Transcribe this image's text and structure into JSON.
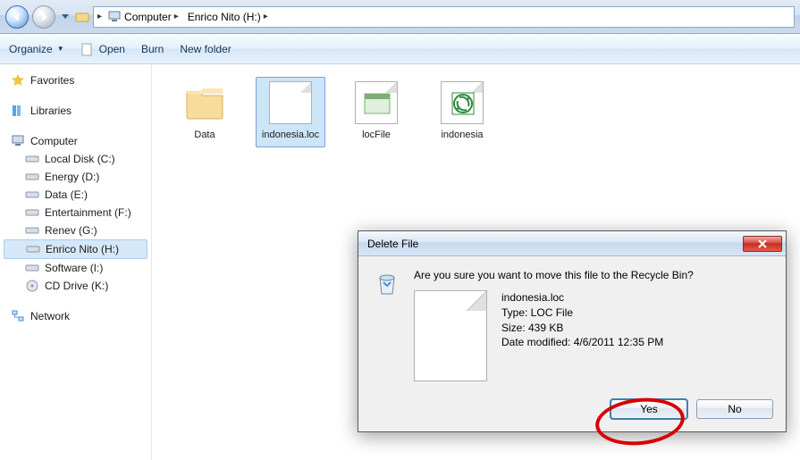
{
  "nav": {
    "crumbs": [
      "Computer",
      "Enrico Nito (H:)"
    ]
  },
  "toolbar": {
    "organize": "Organize",
    "open": "Open",
    "burn": "Burn",
    "newfolder": "New folder"
  },
  "sidebar": {
    "favorites": "Favorites",
    "libraries": "Libraries",
    "computer": "Computer",
    "drives": [
      "Local Disk (C:)",
      "Energy (D:)",
      "Data (E:)",
      "Entertainment (F:)",
      "Renev (G:)",
      "Enrico Nito (H:)",
      "Software (I:)",
      "CD Drive (K:)"
    ],
    "network": "Network"
  },
  "files": [
    {
      "name": "Data",
      "kind": "folder"
    },
    {
      "name": "indonesia.loc",
      "kind": "file",
      "selected": true
    },
    {
      "name": "locFile",
      "kind": "file-loc"
    },
    {
      "name": "indonesia",
      "kind": "file-xls"
    }
  ],
  "dialog": {
    "title": "Delete File",
    "question": "Are you sure you want to move this file to the Recycle Bin?",
    "filename": "indonesia.loc",
    "type": "Type: LOC File",
    "size": "Size: 439 KB",
    "modified": "Date modified: 4/6/2011 12:35 PM",
    "yes": "Yes",
    "no": "No"
  }
}
